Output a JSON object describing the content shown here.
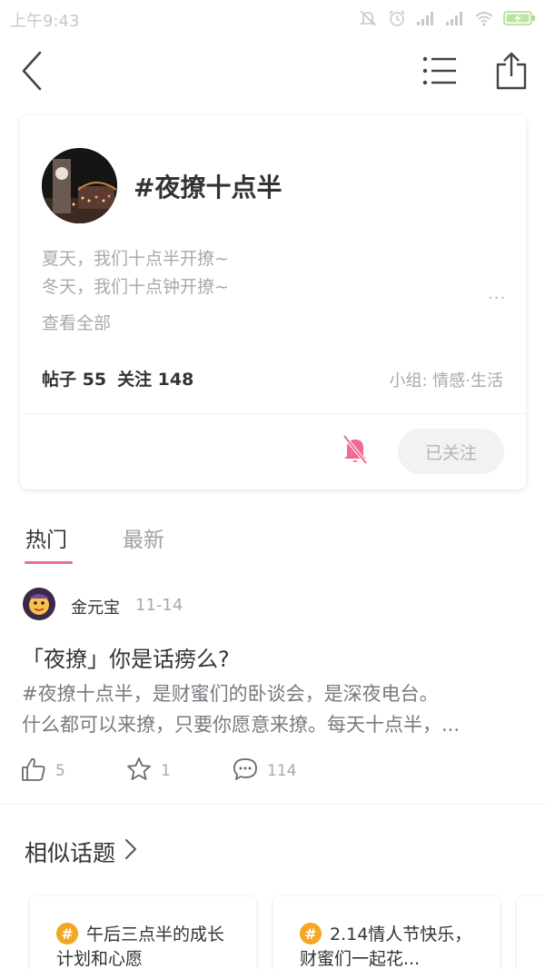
{
  "status_bar": {
    "time": "上午9:43",
    "icons": [
      "mute-icon",
      "alarm-icon",
      "signal-icon",
      "signal-icon",
      "wifi-icon",
      "battery-charging-icon"
    ]
  },
  "nav": {
    "back_icon": "chevron-left-icon",
    "list_icon": "list-icon",
    "share_icon": "share-icon"
  },
  "topic": {
    "title": "#夜撩十点半",
    "desc_line1": "夏天，我们十点半开撩~",
    "desc_line2": "冬天，我们十点钟开撩~",
    "more": "...",
    "view_all": "查看全部",
    "posts_label": "帖子 55",
    "follows_label": "关注 148",
    "group": "小组: 情感·生活",
    "follow_button": "已关注"
  },
  "tabs": [
    {
      "label": "热门",
      "active": true
    },
    {
      "label": "最新",
      "active": false
    }
  ],
  "post": {
    "author": "金元宝",
    "date": "11-14",
    "title": "「夜撩」你是话痨么?",
    "body_line1": "#夜撩十点半，是财蜜们的卧谈会，是深夜电台。",
    "body_line2": "什么都可以来撩，只要你愿意来撩。每天十点半，...",
    "likes": "5",
    "favorites": "1",
    "comments": "114"
  },
  "similar": {
    "title": "相似话题",
    "items": [
      {
        "label": "午后三点半的成长计划和心愿"
      },
      {
        "label": "2.14情人节快乐，财蜜们一起花..."
      }
    ]
  },
  "colors": {
    "accent_pink": "#f06a91",
    "badge_orange": "#f5a623"
  }
}
